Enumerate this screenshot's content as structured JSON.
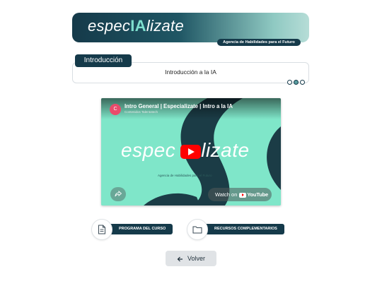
{
  "header": {
    "brand_prefix": "espec",
    "brand_highlight": "IA",
    "brand_suffix": "lizate",
    "tagline": "Agencia de Habilidades para el Futuro"
  },
  "intro": {
    "tab_label": "Introducción",
    "content": "Introducción a la IA",
    "dots": 3,
    "active_dot": 2
  },
  "video": {
    "channel_initial": "C",
    "title": "Intro General | Especializate | Intro a la IA",
    "channel_name": "Contenidos Talentotech",
    "brand_left": "espec",
    "brand_right": "lizate",
    "brand_sub": "Agencia de Habilidades para el Futuro",
    "watch_on": "Watch on",
    "youtube": "YouTube",
    "play_icon": "play-icon",
    "share_icon": "share-icon"
  },
  "resources": {
    "program_label": "PROGRAMA DEL CURSO",
    "program_icon": "document-icon",
    "complementary_label": "RECURSOS COMPLEMENTARIOS",
    "complementary_icon": "folder-icon"
  },
  "back": {
    "label": "Volver",
    "icon": "arrow-left-icon"
  },
  "colors": {
    "primary": "#153a4a",
    "accent": "#7fe6c9",
    "youtube_red": "#ff0000"
  }
}
